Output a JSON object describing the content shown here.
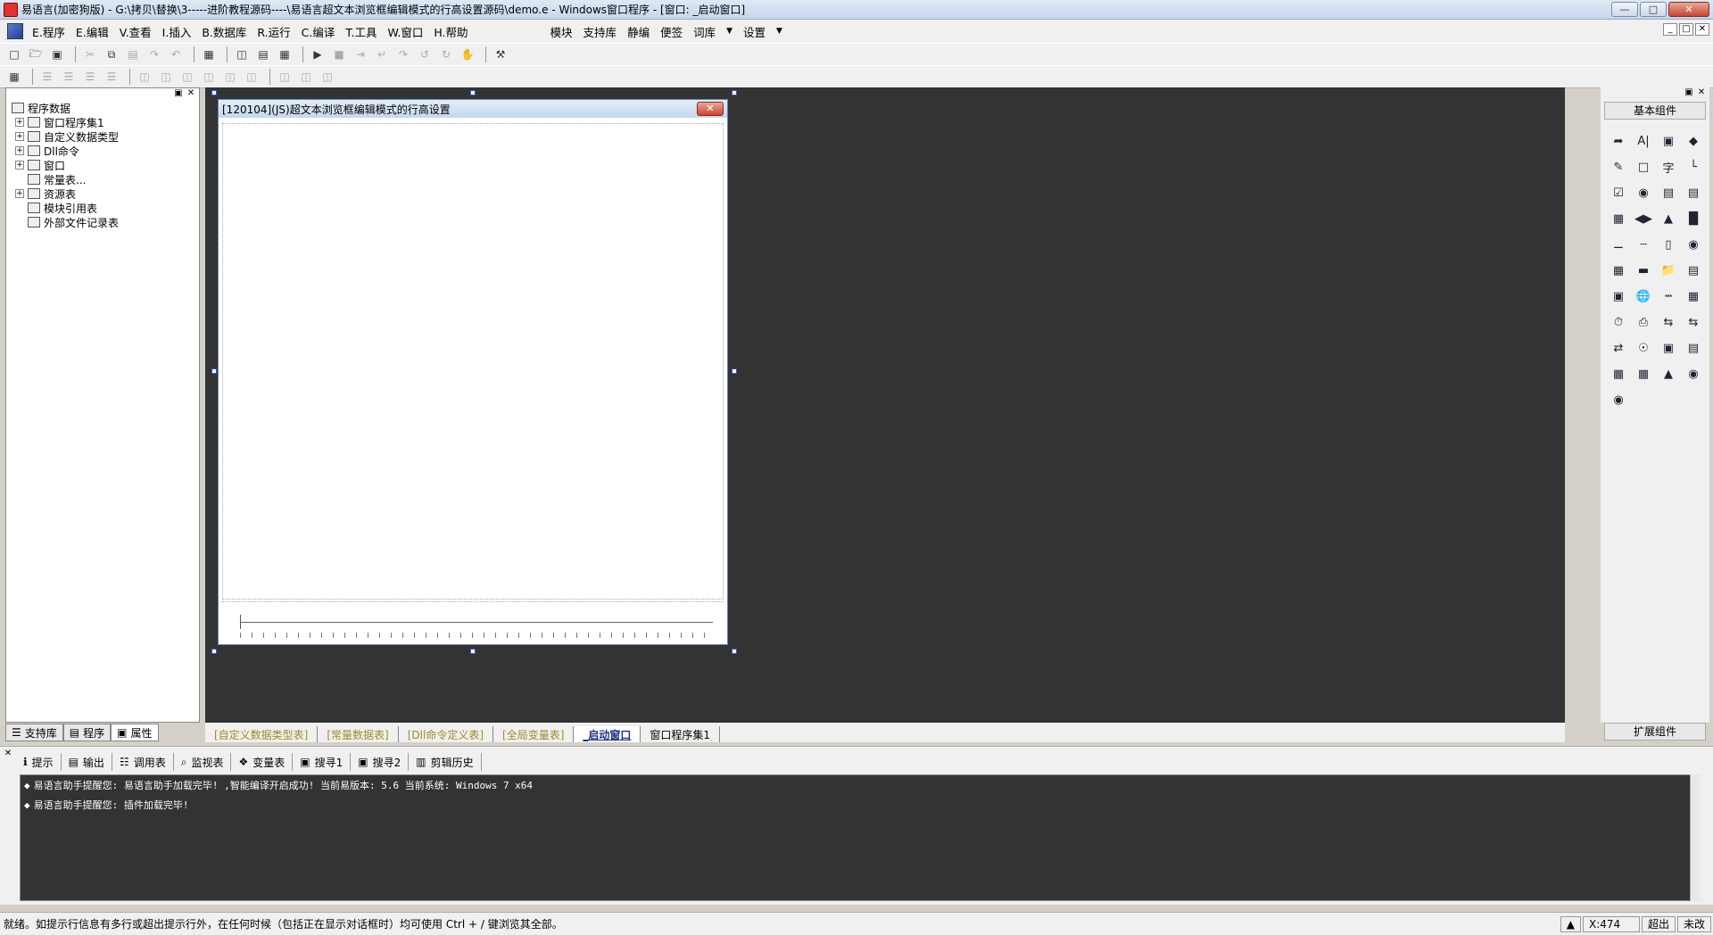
{
  "window": {
    "title": "易语言(加密狗版) - G:\\拷贝\\替换\\3-----进阶教程源码----\\易语言超文本浏览框编辑模式的行高设置源码\\demo.e - Windows窗口程序 - [窗口: _启动窗口]",
    "minimize": "—",
    "maximize": "□",
    "close": "✕"
  },
  "menubar": {
    "items": [
      "E.程序",
      "E.编辑",
      "V.查看",
      "I.插入",
      "B.数据库",
      "R.运行",
      "C.编译",
      "T.工具",
      "W.窗口",
      "H.帮助"
    ],
    "extra": [
      "模块",
      "支持库",
      "静编",
      "便签",
      "词库",
      "▼",
      "设置",
      "▼"
    ],
    "mdi": [
      "_",
      "□",
      "✕"
    ]
  },
  "left_panel": {
    "tree_root": "程序数据",
    "tree_items": [
      {
        "label": "窗口程序集1",
        "expandable": true
      },
      {
        "label": "自定义数据类型",
        "expandable": true
      },
      {
        "label": "Dll命令",
        "expandable": true
      },
      {
        "label": "窗口",
        "expandable": true
      },
      {
        "label": "常量表...",
        "expandable": false
      },
      {
        "label": "资源表",
        "expandable": true
      },
      {
        "label": "模块引用表",
        "expandable": false
      },
      {
        "label": "外部文件记录表",
        "expandable": false
      }
    ],
    "tabs": [
      "支持库",
      "程序",
      "属性"
    ]
  },
  "design": {
    "form_title": "[120104](JS)超文本浏览框编辑模式的行高设置",
    "form_close": "✕"
  },
  "doc_tabs": [
    {
      "label": "[自定义数据类型表]",
      "kind": "yellow"
    },
    {
      "label": "[常量数据表]",
      "kind": "yellow"
    },
    {
      "label": "[Dll命令定义表]",
      "kind": "yellow"
    },
    {
      "label": "[全局变量表]",
      "kind": "yellow"
    },
    {
      "label": "_启动窗口",
      "kind": "active"
    },
    {
      "label": "窗口程序集1",
      "kind": "plain"
    }
  ],
  "palette": {
    "header": "基本组件",
    "footer": "扩展组件"
  },
  "bottom_tabs": [
    {
      "icon": "lightbulb-icon",
      "glyph": "ℹ",
      "label": "提示"
    },
    {
      "icon": "output-icon",
      "glyph": "▤",
      "label": "输出"
    },
    {
      "icon": "call-table-icon",
      "glyph": "☷",
      "label": "调用表"
    },
    {
      "icon": "magnifier-icon",
      "glyph": "⌕",
      "label": "监视表"
    },
    {
      "icon": "variable-icon",
      "glyph": "❖",
      "label": "变量表"
    },
    {
      "icon": "search-icon",
      "glyph": "▣",
      "label": "搜寻1"
    },
    {
      "icon": "search2-icon",
      "glyph": "▣",
      "label": "搜寻2"
    },
    {
      "icon": "clipboard-icon",
      "glyph": "▥",
      "label": "剪辑历史"
    }
  ],
  "output": {
    "lines": [
      "易语言助手提醒您: 易语言助手加载完毕! ,智能编译开启成功! 当前易版本: 5.6 当前系统: Windows 7 x64",
      "易语言助手提醒您: 插件加载完毕!"
    ]
  },
  "status": {
    "text": "就绪。如提示行信息有多行或超出提示行外，在任何时候（包括正在显示对话框时）均可使用 Ctrl + / 键浏览其全部。",
    "coord": "X:474",
    "mode": "超出",
    "caps": "未改"
  }
}
